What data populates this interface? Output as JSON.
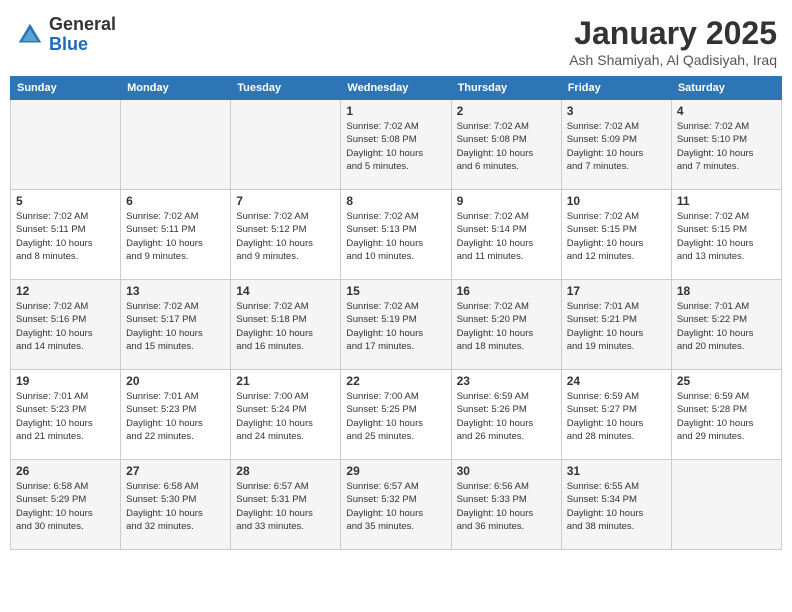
{
  "header": {
    "logo_general": "General",
    "logo_blue": "Blue",
    "month_title": "January 2025",
    "location": "Ash Shamiyah, Al Qadisiyah, Iraq"
  },
  "weekdays": [
    "Sunday",
    "Monday",
    "Tuesday",
    "Wednesday",
    "Thursday",
    "Friday",
    "Saturday"
  ],
  "weeks": [
    [
      {
        "day": "",
        "info": ""
      },
      {
        "day": "",
        "info": ""
      },
      {
        "day": "",
        "info": ""
      },
      {
        "day": "1",
        "info": "Sunrise: 7:02 AM\nSunset: 5:08 PM\nDaylight: 10 hours\nand 5 minutes."
      },
      {
        "day": "2",
        "info": "Sunrise: 7:02 AM\nSunset: 5:08 PM\nDaylight: 10 hours\nand 6 minutes."
      },
      {
        "day": "3",
        "info": "Sunrise: 7:02 AM\nSunset: 5:09 PM\nDaylight: 10 hours\nand 7 minutes."
      },
      {
        "day": "4",
        "info": "Sunrise: 7:02 AM\nSunset: 5:10 PM\nDaylight: 10 hours\nand 7 minutes."
      }
    ],
    [
      {
        "day": "5",
        "info": "Sunrise: 7:02 AM\nSunset: 5:11 PM\nDaylight: 10 hours\nand 8 minutes."
      },
      {
        "day": "6",
        "info": "Sunrise: 7:02 AM\nSunset: 5:11 PM\nDaylight: 10 hours\nand 9 minutes."
      },
      {
        "day": "7",
        "info": "Sunrise: 7:02 AM\nSunset: 5:12 PM\nDaylight: 10 hours\nand 9 minutes."
      },
      {
        "day": "8",
        "info": "Sunrise: 7:02 AM\nSunset: 5:13 PM\nDaylight: 10 hours\nand 10 minutes."
      },
      {
        "day": "9",
        "info": "Sunrise: 7:02 AM\nSunset: 5:14 PM\nDaylight: 10 hours\nand 11 minutes."
      },
      {
        "day": "10",
        "info": "Sunrise: 7:02 AM\nSunset: 5:15 PM\nDaylight: 10 hours\nand 12 minutes."
      },
      {
        "day": "11",
        "info": "Sunrise: 7:02 AM\nSunset: 5:15 PM\nDaylight: 10 hours\nand 13 minutes."
      }
    ],
    [
      {
        "day": "12",
        "info": "Sunrise: 7:02 AM\nSunset: 5:16 PM\nDaylight: 10 hours\nand 14 minutes."
      },
      {
        "day": "13",
        "info": "Sunrise: 7:02 AM\nSunset: 5:17 PM\nDaylight: 10 hours\nand 15 minutes."
      },
      {
        "day": "14",
        "info": "Sunrise: 7:02 AM\nSunset: 5:18 PM\nDaylight: 10 hours\nand 16 minutes."
      },
      {
        "day": "15",
        "info": "Sunrise: 7:02 AM\nSunset: 5:19 PM\nDaylight: 10 hours\nand 17 minutes."
      },
      {
        "day": "16",
        "info": "Sunrise: 7:02 AM\nSunset: 5:20 PM\nDaylight: 10 hours\nand 18 minutes."
      },
      {
        "day": "17",
        "info": "Sunrise: 7:01 AM\nSunset: 5:21 PM\nDaylight: 10 hours\nand 19 minutes."
      },
      {
        "day": "18",
        "info": "Sunrise: 7:01 AM\nSunset: 5:22 PM\nDaylight: 10 hours\nand 20 minutes."
      }
    ],
    [
      {
        "day": "19",
        "info": "Sunrise: 7:01 AM\nSunset: 5:23 PM\nDaylight: 10 hours\nand 21 minutes."
      },
      {
        "day": "20",
        "info": "Sunrise: 7:01 AM\nSunset: 5:23 PM\nDaylight: 10 hours\nand 22 minutes."
      },
      {
        "day": "21",
        "info": "Sunrise: 7:00 AM\nSunset: 5:24 PM\nDaylight: 10 hours\nand 24 minutes."
      },
      {
        "day": "22",
        "info": "Sunrise: 7:00 AM\nSunset: 5:25 PM\nDaylight: 10 hours\nand 25 minutes."
      },
      {
        "day": "23",
        "info": "Sunrise: 6:59 AM\nSunset: 5:26 PM\nDaylight: 10 hours\nand 26 minutes."
      },
      {
        "day": "24",
        "info": "Sunrise: 6:59 AM\nSunset: 5:27 PM\nDaylight: 10 hours\nand 28 minutes."
      },
      {
        "day": "25",
        "info": "Sunrise: 6:59 AM\nSunset: 5:28 PM\nDaylight: 10 hours\nand 29 minutes."
      }
    ],
    [
      {
        "day": "26",
        "info": "Sunrise: 6:58 AM\nSunset: 5:29 PM\nDaylight: 10 hours\nand 30 minutes."
      },
      {
        "day": "27",
        "info": "Sunrise: 6:58 AM\nSunset: 5:30 PM\nDaylight: 10 hours\nand 32 minutes."
      },
      {
        "day": "28",
        "info": "Sunrise: 6:57 AM\nSunset: 5:31 PM\nDaylight: 10 hours\nand 33 minutes."
      },
      {
        "day": "29",
        "info": "Sunrise: 6:57 AM\nSunset: 5:32 PM\nDaylight: 10 hours\nand 35 minutes."
      },
      {
        "day": "30",
        "info": "Sunrise: 6:56 AM\nSunset: 5:33 PM\nDaylight: 10 hours\nand 36 minutes."
      },
      {
        "day": "31",
        "info": "Sunrise: 6:55 AM\nSunset: 5:34 PM\nDaylight: 10 hours\nand 38 minutes."
      },
      {
        "day": "",
        "info": ""
      }
    ]
  ]
}
